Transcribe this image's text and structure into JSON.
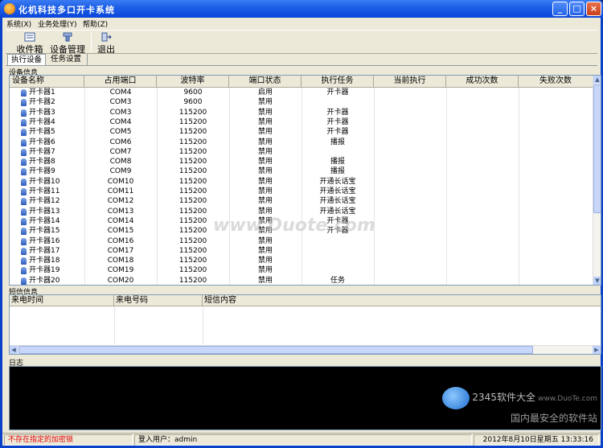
{
  "window": {
    "title": "化机科技多口开卡系统",
    "minimize_label": "_",
    "maximize_label": "□",
    "close_label": "×"
  },
  "menu": [
    "系统(X)",
    "业务处理(Y)",
    "帮助(Z)"
  ],
  "toolbar": {
    "inbox_label": "收件箱",
    "device_mgmt_label": "设备管理",
    "exit_label": "退出"
  },
  "tabs": [
    "执行设备",
    "任务设置"
  ],
  "devices_section_label": "设备信息",
  "device_columns": [
    "设备名称",
    "占用端口",
    "波特率",
    "端口状态",
    "执行任务",
    "当前执行",
    "成功次数",
    "失败次数"
  ],
  "devices": [
    {
      "name": "开卡器1",
      "port": "COM4",
      "baud": "9600",
      "status": "启用",
      "task": "开卡器"
    },
    {
      "name": "开卡器2",
      "port": "COM3",
      "baud": "9600",
      "status": "禁用",
      "task": ""
    },
    {
      "name": "开卡器3",
      "port": "COM3",
      "baud": "115200",
      "status": "禁用",
      "task": "开卡器"
    },
    {
      "name": "开卡器4",
      "port": "COM4",
      "baud": "115200",
      "status": "禁用",
      "task": "开卡器"
    },
    {
      "name": "开卡器5",
      "port": "COM5",
      "baud": "115200",
      "status": "禁用",
      "task": "开卡器"
    },
    {
      "name": "开卡器6",
      "port": "COM6",
      "baud": "115200",
      "status": "禁用",
      "task": "播报"
    },
    {
      "name": "开卡器7",
      "port": "COM7",
      "baud": "115200",
      "status": "禁用",
      "task": ""
    },
    {
      "name": "开卡器8",
      "port": "COM8",
      "baud": "115200",
      "status": "禁用",
      "task": "播报"
    },
    {
      "name": "开卡器9",
      "port": "COM9",
      "baud": "115200",
      "status": "禁用",
      "task": "播报"
    },
    {
      "name": "开卡器10",
      "port": "COM10",
      "baud": "115200",
      "status": "禁用",
      "task": "开通长话宝"
    },
    {
      "name": "开卡器11",
      "port": "COM11",
      "baud": "115200",
      "status": "禁用",
      "task": "开通长话宝"
    },
    {
      "name": "开卡器12",
      "port": "COM12",
      "baud": "115200",
      "status": "禁用",
      "task": "开通长话宝"
    },
    {
      "name": "开卡器13",
      "port": "COM13",
      "baud": "115200",
      "status": "禁用",
      "task": "开通长话宝"
    },
    {
      "name": "开卡器14",
      "port": "COM14",
      "baud": "115200",
      "status": "禁用",
      "task": "开卡器"
    },
    {
      "name": "开卡器15",
      "port": "COM15",
      "baud": "115200",
      "status": "禁用",
      "task": "开卡器"
    },
    {
      "name": "开卡器16",
      "port": "COM16",
      "baud": "115200",
      "status": "禁用",
      "task": ""
    },
    {
      "name": "开卡器17",
      "port": "COM17",
      "baud": "115200",
      "status": "禁用",
      "task": ""
    },
    {
      "name": "开卡器18",
      "port": "COM18",
      "baud": "115200",
      "status": "禁用",
      "task": ""
    },
    {
      "name": "开卡器19",
      "port": "COM19",
      "baud": "115200",
      "status": "禁用",
      "task": ""
    },
    {
      "name": "开卡器20",
      "port": "COM20",
      "baud": "115200",
      "status": "禁用",
      "task": "任务"
    }
  ],
  "sms_section_label": "短信信息",
  "sms_columns": [
    "来电时间",
    "来电号码",
    "短信内容"
  ],
  "log_section_label": "日志",
  "watermark": {
    "overlay_text": "www.Duote.com",
    "logo_text": "2345软件大全",
    "site_text": "www.DuoTe.com",
    "slogan": "国内最安全的软件站"
  },
  "statusbar": {
    "message": "不存在指定的加密锁",
    "user_label": "登入用户：admin",
    "datetime": "2012年8月10日星期五  13:33:16"
  },
  "colors": {
    "error_text": "#e00000",
    "titlebar": "#0b46d8"
  }
}
